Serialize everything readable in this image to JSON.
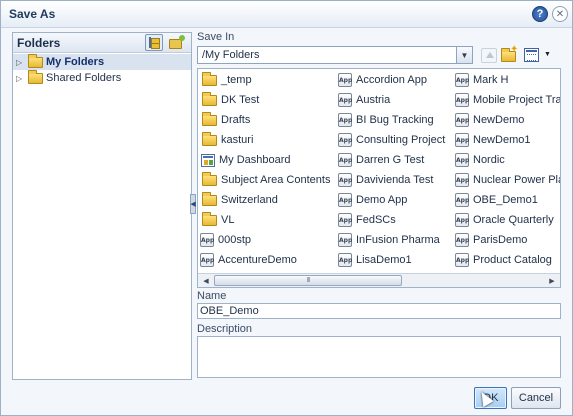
{
  "dialog": {
    "title": "Save As",
    "help_icon": "question-mark-icon",
    "close_icon": "x-icon"
  },
  "folders_panel": {
    "title": "Folders",
    "header_icons": [
      "folder-tree-icon",
      "new-folder-icon"
    ],
    "items": [
      {
        "label": "My Folders",
        "selected": true
      },
      {
        "label": "Shared Folders",
        "selected": false
      }
    ]
  },
  "save_in": {
    "label": "Save In",
    "value": "/My Folders",
    "toolbar_icons": [
      "up-folder-icon",
      "new-folder-icon",
      "view-icon"
    ]
  },
  "file_list": {
    "columns": [
      [
        {
          "label": "_temp",
          "icon": "folder-icon"
        },
        {
          "label": "DK Test",
          "icon": "folder-icon"
        },
        {
          "label": "Drafts",
          "icon": "folder-icon"
        },
        {
          "label": "kasturi",
          "icon": "folder-icon"
        },
        {
          "label": "My Dashboard",
          "icon": "dashboard-icon"
        },
        {
          "label": "Subject Area Contents",
          "icon": "folder-icon"
        },
        {
          "label": "Switzerland",
          "icon": "folder-icon"
        },
        {
          "label": "VL",
          "icon": "folder-icon"
        },
        {
          "label": "000stp",
          "icon": "app-icon"
        },
        {
          "label": "AccentureDemo",
          "icon": "app-icon"
        }
      ],
      [
        {
          "label": "Accordion App",
          "icon": "app-icon"
        },
        {
          "label": "Austria",
          "icon": "app-icon"
        },
        {
          "label": "BI Bug Tracking",
          "icon": "app-icon"
        },
        {
          "label": "Consulting Project",
          "icon": "app-icon"
        },
        {
          "label": "Darren G Test",
          "icon": "app-icon"
        },
        {
          "label": "Davivienda Test",
          "icon": "app-icon"
        },
        {
          "label": "Demo App",
          "icon": "app-icon"
        },
        {
          "label": "FedSCs",
          "icon": "app-icon"
        },
        {
          "label": "InFusion Pharma",
          "icon": "app-icon"
        },
        {
          "label": "LisaDemo1",
          "icon": "app-icon"
        }
      ],
      [
        {
          "label": "Mark H",
          "icon": "app-icon"
        },
        {
          "label": "Mobile Project Tra",
          "icon": "app-icon"
        },
        {
          "label": "NewDemo",
          "icon": "app-icon"
        },
        {
          "label": "NewDemo1",
          "icon": "app-icon"
        },
        {
          "label": "Nordic",
          "icon": "app-icon"
        },
        {
          "label": "Nuclear Power Pla",
          "icon": "app-icon"
        },
        {
          "label": "OBE_Demo1",
          "icon": "app-icon"
        },
        {
          "label": "Oracle Quarterly",
          "icon": "app-icon"
        },
        {
          "label": "ParisDemo",
          "icon": "app-icon"
        },
        {
          "label": "Product Catalog",
          "icon": "app-icon"
        }
      ]
    ],
    "app_icon_text": "App",
    "scrollbar_grip": "III"
  },
  "name_field": {
    "label": "Name",
    "value": "OBE_Demo"
  },
  "description_field": {
    "label": "Description",
    "value": ""
  },
  "buttons": {
    "ok": "OK",
    "cancel": "Cancel"
  },
  "colors": {
    "accent": "#3b73b9",
    "selection": "#d9e3f0",
    "folder": "#e6b934"
  }
}
